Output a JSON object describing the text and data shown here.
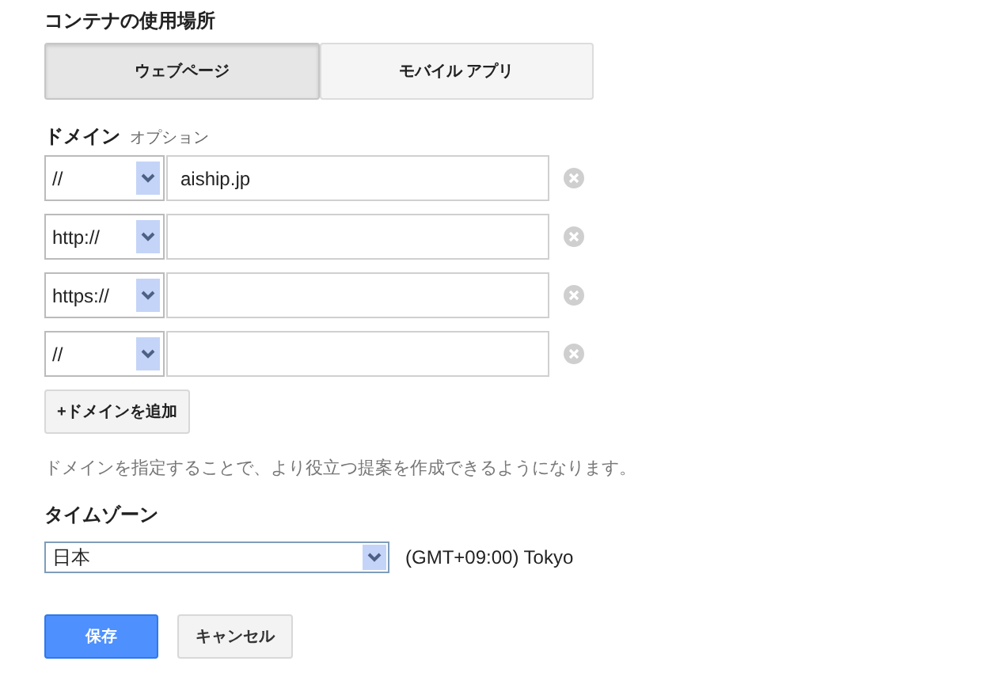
{
  "section_title": "コンテナの使用場所",
  "tabs": [
    {
      "label": "ウェブページ",
      "selected": true
    },
    {
      "label": "モバイル アプリ",
      "selected": false
    }
  ],
  "domain": {
    "label": "ドメイン",
    "optional": "オプション",
    "rows": [
      {
        "protocol": "//",
        "value": "aiship.jp"
      },
      {
        "protocol": "http://"
      },
      {
        "protocol": "https://"
      },
      {
        "protocol": "//"
      }
    ],
    "add_button": "+ドメインを追加",
    "hint": "ドメインを指定することで、より役立つ提案を作成できるようになります。"
  },
  "timezone": {
    "label": "タイムゾーン",
    "value": "日本",
    "offset": "(GMT+09:00) Tokyo"
  },
  "buttons": {
    "save": "保存",
    "cancel": "キャンセル"
  }
}
